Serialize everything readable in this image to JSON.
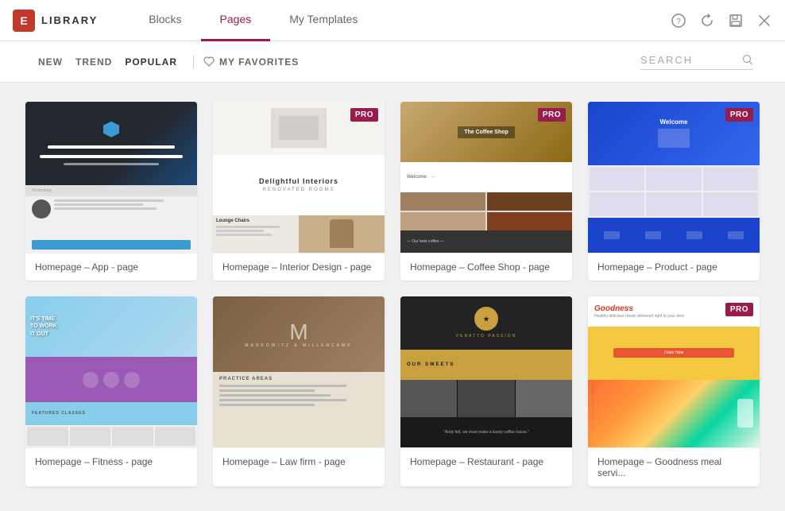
{
  "header": {
    "logo_text": "LIBRARY",
    "logo_icon": "E",
    "tabs": [
      {
        "id": "blocks",
        "label": "Blocks",
        "active": false
      },
      {
        "id": "pages",
        "label": "Pages",
        "active": true
      },
      {
        "id": "my-templates",
        "label": "My Templates",
        "active": false
      }
    ],
    "actions": {
      "help": "?",
      "refresh": "↻",
      "save": "💾",
      "close": "✕"
    }
  },
  "filters": {
    "items": [
      {
        "id": "new",
        "label": "NEW",
        "active": false
      },
      {
        "id": "trend",
        "label": "TREND",
        "active": false
      },
      {
        "id": "popular",
        "label": "POPULAR",
        "active": false
      }
    ],
    "favorites_label": "MY FAVORITES",
    "search_placeholder": "SEARCH"
  },
  "cards": [
    {
      "id": "app",
      "label": "Homepage – App - page",
      "pro": false,
      "template_type": "app"
    },
    {
      "id": "interior",
      "label": "Homepage – Interior Design - page",
      "pro": true,
      "template_type": "interior"
    },
    {
      "id": "coffee",
      "label": "Homepage – Coffee Shop - page",
      "pro": true,
      "template_type": "coffee"
    },
    {
      "id": "product",
      "label": "Homepage – Product - page",
      "pro": true,
      "template_type": "product"
    },
    {
      "id": "fitness",
      "label": "Homepage – Fitness - page",
      "pro": false,
      "template_type": "fitness"
    },
    {
      "id": "law",
      "label": "Homepage – Law firm - page",
      "pro": false,
      "template_type": "law"
    },
    {
      "id": "restaurant",
      "label": "Homepage – Restaurant - page",
      "pro": false,
      "template_type": "restaurant"
    },
    {
      "id": "goodness",
      "label": "Homepage – Goodness meal servi...",
      "pro": true,
      "template_type": "goodness"
    }
  ],
  "badges": {
    "pro_label": "PRO"
  }
}
